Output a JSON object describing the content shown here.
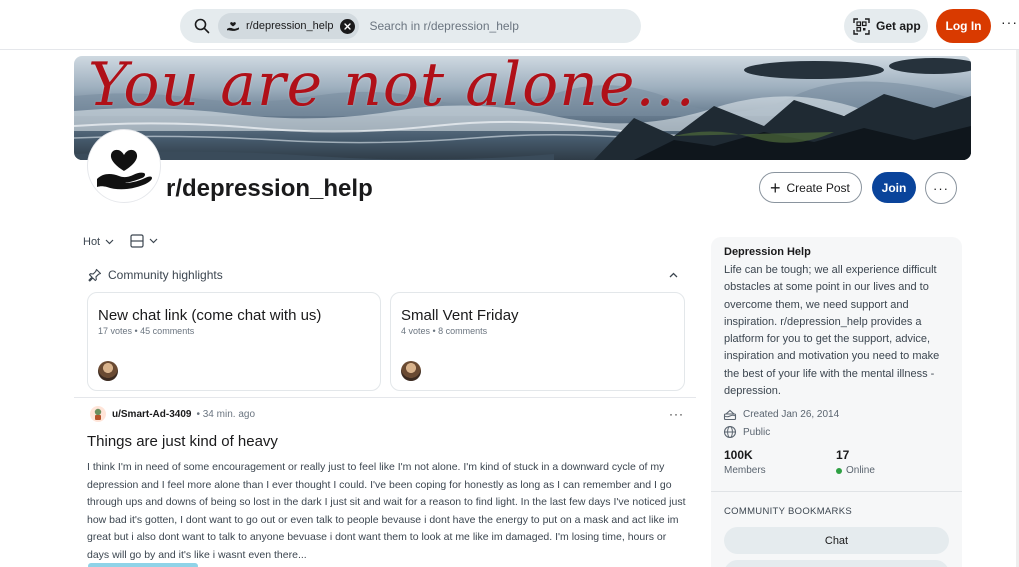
{
  "header": {
    "subreddit_chip": "r/depression_help",
    "search_placeholder": "Search in r/depression_help",
    "get_app": "Get app",
    "login": "Log In",
    "more": "···"
  },
  "banner": {
    "text": "You are not alone..."
  },
  "community": {
    "name": "r/depression_help",
    "create_post": "Create Post",
    "join": "Join",
    "more": "···"
  },
  "feed": {
    "sort": "Hot",
    "highlights_label": "Community highlights",
    "highlights": [
      {
        "title": "New chat link (come chat with us)",
        "meta": "17 votes • 45 comments"
      },
      {
        "title": "Small Vent Friday",
        "meta": "4 votes • 8 comments"
      }
    ],
    "post": {
      "user": "u/Smart-Ad-3409",
      "time": "• 34 min. ago",
      "title": "Things are just kind of heavy",
      "body": "I think I'm in need of some encouragement or really just to feel like I'm not alone. I'm kind of stuck in a downward cycle of my depression and I feel more alone than I ever thought I could. I've been coping for honestly as long as I can remember and I go through ups and downs of being so lost in the dark I just sit and wait for a reason to find light. In the last few days I've noticed just how bad it's gotten, I dont want to go out or even talk to people bevause i dont have the energy to put on a mask and act like im great but i also dont want to talk to anyone bevuase i dont want them to look at me like im damaged. I'm losing time, hours or days will go by and it's like i wasnt even there..."
    }
  },
  "sidebar": {
    "title": "Depression Help",
    "description": "Life can be tough; we all experience difficult obstacles at some point in our lives and to overcome them, we need support and inspiration. r/depression_help provides a platform for you to get the support, advice, inspiration and motivation you need to make the best of your life with the mental illness - depression.",
    "created": "Created Jan 26, 2014",
    "visibility": "Public",
    "members_count": "100K",
    "members_label": "Members",
    "online_count": "17",
    "online_label": "Online",
    "bookmarks_heading": "COMMUNITY BOOKMARKS",
    "bookmarks": [
      "Chat"
    ]
  },
  "colors": {
    "login": "#d93a00",
    "join": "#0a449b",
    "banner_text": "#b01018",
    "online": "#2ea043"
  }
}
